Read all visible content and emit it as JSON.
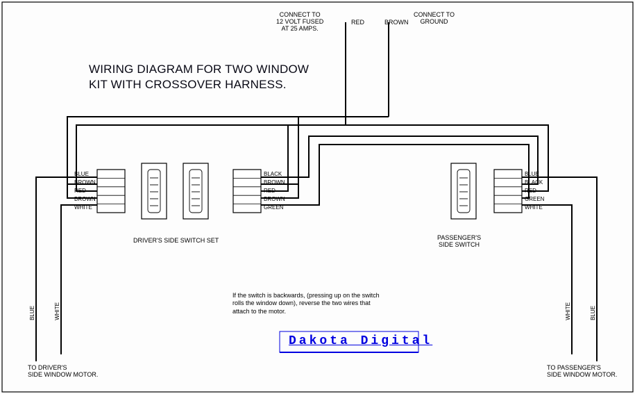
{
  "title_line1": "WIRING DIAGRAM FOR TWO WINDOW",
  "title_line2": "KIT WITH CROSSOVER HARNESS.",
  "top": {
    "fused": "CONNECT TO\n12 VOLT FUSED\nAT 25 AMPS.",
    "ground": "CONNECT TO\nGROUND",
    "red": "RED",
    "brown": "BROWN"
  },
  "driver_conn": {
    "pins": [
      "BLUE",
      "BROWN",
      "RED",
      "BROWN",
      "WHITE"
    ]
  },
  "center_conn": {
    "pins": [
      "BLACK",
      "BROWN",
      "RED",
      "BROWN",
      "GREEN"
    ]
  },
  "passenger_conn": {
    "pins": [
      "BLUE",
      "BLACK",
      "RED",
      "GREEN",
      "WHITE"
    ]
  },
  "labels": {
    "driver_switch": "DRIVER'S SIDE SWITCH SET",
    "passenger_switch": "PASSENGER'S\nSIDE SWITCH",
    "to_driver_motor": "TO DRIVER'S\nSIDE WINDOW MOTOR.",
    "to_passenger_motor": "TO PASSENGER'S\nSIDE WINDOW MOTOR."
  },
  "vertical_wires": {
    "driver_outer": "BLUE",
    "driver_inner": "WHITE",
    "passenger_inner": "WHITE",
    "passenger_outer": "BLUE"
  },
  "note": "If the switch is backwards, (pressing up on the\nswitch rolls the window down), reverse the two\nwires that attach to the motor.",
  "brand": "Dakota Digital"
}
